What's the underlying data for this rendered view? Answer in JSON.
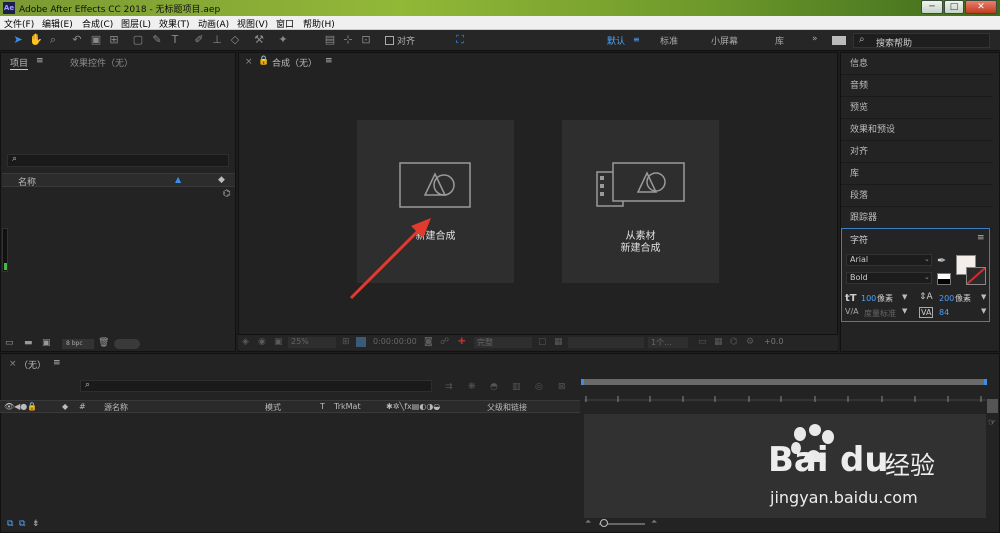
{
  "window": {
    "title": "Adobe After Effects CC 2018 - 无标题项目.aep",
    "app_icon": "Ae",
    "controls": {
      "minimize": "─",
      "maximize": "□",
      "close": "✕"
    }
  },
  "menu": [
    "文件(F)",
    "编辑(E)",
    "合成(C)",
    "图层(L)",
    "效果(T)",
    "动画(A)",
    "视图(V)",
    "窗口",
    "帮助(H)"
  ],
  "toolbar": {
    "align_label": "对齐",
    "workspaces": [
      "默认",
      "标准",
      "小屏幕",
      "库"
    ],
    "active_workspace": "默认",
    "overflow": "»",
    "search_placeholder": "搜索帮助"
  },
  "project_panel": {
    "tab_project": "项目",
    "tab_effects": "效果控件（无）",
    "column_name": "名称",
    "bpc": "8 bpc"
  },
  "composition_panel": {
    "tab_label": "合成（无）",
    "card_new": {
      "label": "新建合成"
    },
    "card_from_footage": {
      "line1": "从素材",
      "line2": "新建合成"
    },
    "footer": {
      "zoom": "25%",
      "timecode": "0:00:00:00",
      "quality": "完整",
      "views": "1个...",
      "offset": "+0.0"
    }
  },
  "right_panel": {
    "items": [
      "信息",
      "音频",
      "预览",
      "效果和预设",
      "对齐",
      "库",
      "段落",
      "跟踪器"
    ],
    "character": {
      "title": "字符",
      "font": "Arial",
      "style": "Bold",
      "size_value": "100",
      "size_unit": "像素",
      "leading_value": "200",
      "leading_unit": "像素",
      "kerning": "度量标准",
      "tracking": "84"
    }
  },
  "timeline": {
    "tab_label": "（无）",
    "columns": {
      "source_name": "源名称",
      "mode": "模式",
      "t": "T",
      "trkmat": "TrkMat",
      "parent": "父级和链接",
      "number": "#"
    }
  },
  "watermark": {
    "brand": "Bai",
    "brand_cn": "经验",
    "url": "jingyan.baidu.com"
  },
  "colors": {
    "accent": "#3b8ee8",
    "arrow": "#e23a2c",
    "panel_bg": "#232323",
    "card_bg": "#2e2e2e"
  }
}
